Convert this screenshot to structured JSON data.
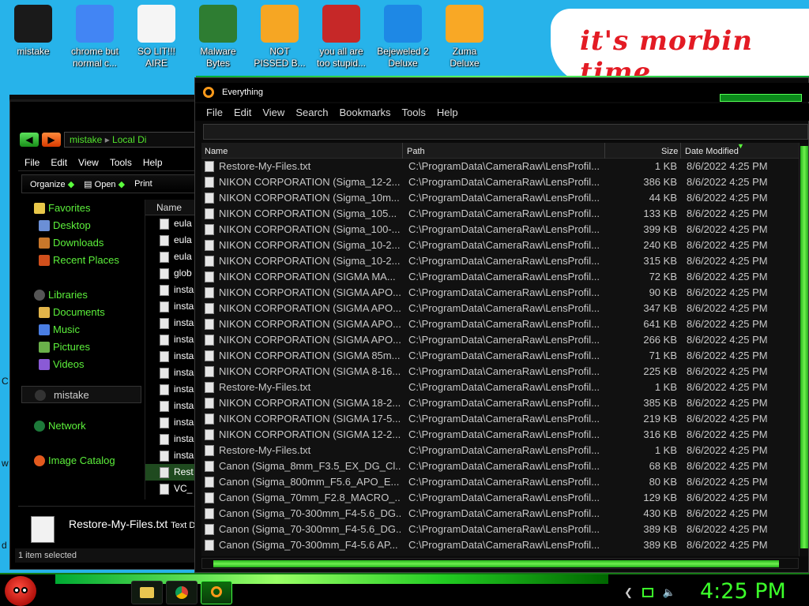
{
  "desktop": {
    "icons": [
      {
        "label": "mistake",
        "icon": "black-disc-icon",
        "color": "#1a1a1a"
      },
      {
        "label": "chrome but\nnormal c...",
        "icon": "chrome-icon",
        "color": "#4285f4"
      },
      {
        "label": "SO LIT!!!\nAIRE",
        "icon": "solitaire-card-icon",
        "color": "#f5f5f5"
      },
      {
        "label": "Malware\nBytes",
        "icon": "shield-check-icon",
        "color": "#2e7d32"
      },
      {
        "label": "NOT\nPISSED B...",
        "icon": "green-pig-icon",
        "color": "#f6a623"
      },
      {
        "label": "you all are\ntoo stupid...",
        "icon": "devcpp-icon",
        "color": "#c62828"
      },
      {
        "label": "Bejeweled 2\nDeluxe",
        "icon": "gem-icon",
        "color": "#1e88e5"
      },
      {
        "label": "Zuma\nDeluxe",
        "icon": "zuma-icon",
        "color": "#f9a825"
      }
    ],
    "sticker_text": "it's morbin time",
    "edge_letters": [
      "C",
      "w",
      "d"
    ]
  },
  "explorer": {
    "address_segments": [
      "mistake",
      "Local Di"
    ],
    "menu": [
      "File",
      "Edit",
      "View",
      "Tools",
      "Help"
    ],
    "toolbar": {
      "organize": "Organize",
      "open": "Open",
      "print": "Print"
    },
    "sidebar": {
      "favorites": "Favorites",
      "favorites_items": [
        "Desktop",
        "Downloads",
        "Recent Places"
      ],
      "libraries": "Libraries",
      "libraries_items": [
        "Documents",
        "Music",
        "Pictures",
        "Videos"
      ],
      "location": "mistake",
      "network": "Network",
      "image_catalog": "Image Catalog"
    },
    "list_header": "Name",
    "list_items": [
      "eula",
      "eula",
      "eula",
      "glob",
      "insta",
      "insta",
      "insta",
      "insta",
      "insta",
      "insta",
      "insta",
      "insta",
      "insta",
      "insta",
      "insta",
      "Rest",
      "VC_"
    ],
    "detail_name": "Restore-My-Files.txt",
    "detail_type": "Text D",
    "status": "1 item selected"
  },
  "everything": {
    "title": "Everything",
    "menu": [
      "File",
      "Edit",
      "View",
      "Search",
      "Bookmarks",
      "Tools",
      "Help"
    ],
    "search_value": "",
    "columns": [
      "Name",
      "Path",
      "Size",
      "Date Modified"
    ],
    "rows": [
      [
        "Restore-My-Files.txt",
        "C:\\ProgramData\\CameraRaw\\LensProfil...",
        "1 KB",
        "8/6/2022 4:25 PM"
      ],
      [
        "NIKON CORPORATION (Sigma_12-2...",
        "C:\\ProgramData\\CameraRaw\\LensProfil...",
        "386 KB",
        "8/6/2022 4:25 PM"
      ],
      [
        "NIKON CORPORATION (Sigma_10m...",
        "C:\\ProgramData\\CameraRaw\\LensProfil...",
        "44 KB",
        "8/6/2022 4:25 PM"
      ],
      [
        "NIKON CORPORATION (Sigma_105...",
        "C:\\ProgramData\\CameraRaw\\LensProfil...",
        "133 KB",
        "8/6/2022 4:25 PM"
      ],
      [
        "NIKON CORPORATION (Sigma_100-...",
        "C:\\ProgramData\\CameraRaw\\LensProfil...",
        "399 KB",
        "8/6/2022 4:25 PM"
      ],
      [
        "NIKON CORPORATION (Sigma_10-2...",
        "C:\\ProgramData\\CameraRaw\\LensProfil...",
        "240 KB",
        "8/6/2022 4:25 PM"
      ],
      [
        "NIKON CORPORATION (Sigma_10-2...",
        "C:\\ProgramData\\CameraRaw\\LensProfil...",
        "315 KB",
        "8/6/2022 4:25 PM"
      ],
      [
        "NIKON CORPORATION (SIGMA MA...",
        "C:\\ProgramData\\CameraRaw\\LensProfil...",
        "72 KB",
        "8/6/2022 4:25 PM"
      ],
      [
        "NIKON CORPORATION (SIGMA APO...",
        "C:\\ProgramData\\CameraRaw\\LensProfil...",
        "90 KB",
        "8/6/2022 4:25 PM"
      ],
      [
        "NIKON CORPORATION (SIGMA APO...",
        "C:\\ProgramData\\CameraRaw\\LensProfil...",
        "347 KB",
        "8/6/2022 4:25 PM"
      ],
      [
        "NIKON CORPORATION (SIGMA APO...",
        "C:\\ProgramData\\CameraRaw\\LensProfil...",
        "641 KB",
        "8/6/2022 4:25 PM"
      ],
      [
        "NIKON CORPORATION (SIGMA APO...",
        "C:\\ProgramData\\CameraRaw\\LensProfil...",
        "266 KB",
        "8/6/2022 4:25 PM"
      ],
      [
        "NIKON CORPORATION (SIGMA 85m...",
        "C:\\ProgramData\\CameraRaw\\LensProfil...",
        "71 KB",
        "8/6/2022 4:25 PM"
      ],
      [
        "NIKON CORPORATION (SIGMA 8-16...",
        "C:\\ProgramData\\CameraRaw\\LensProfil...",
        "225 KB",
        "8/6/2022 4:25 PM"
      ],
      [
        "Restore-My-Files.txt",
        "C:\\ProgramData\\CameraRaw\\LensProfil...",
        "1 KB",
        "8/6/2022 4:25 PM"
      ],
      [
        "NIKON CORPORATION (SIGMA 18-2...",
        "C:\\ProgramData\\CameraRaw\\LensProfil...",
        "385 KB",
        "8/6/2022 4:25 PM"
      ],
      [
        "NIKON CORPORATION (SIGMA 17-5...",
        "C:\\ProgramData\\CameraRaw\\LensProfil...",
        "219 KB",
        "8/6/2022 4:25 PM"
      ],
      [
        "NIKON CORPORATION (SIGMA 12-2...",
        "C:\\ProgramData\\CameraRaw\\LensProfil...",
        "316 KB",
        "8/6/2022 4:25 PM"
      ],
      [
        "Restore-My-Files.txt",
        "C:\\ProgramData\\CameraRaw\\LensProfil...",
        "1 KB",
        "8/6/2022 4:25 PM"
      ],
      [
        "Canon (Sigma_8mm_F3.5_EX_DG_Cl...",
        "C:\\ProgramData\\CameraRaw\\LensProfil...",
        "68 KB",
        "8/6/2022 4:25 PM"
      ],
      [
        "Canon (Sigma_800mm_F5.6_APO_E...",
        "C:\\ProgramData\\CameraRaw\\LensProfil...",
        "80 KB",
        "8/6/2022 4:25 PM"
      ],
      [
        "Canon (Sigma_70mm_F2.8_MACRO_...",
        "C:\\ProgramData\\CameraRaw\\LensProfil...",
        "129 KB",
        "8/6/2022 4:25 PM"
      ],
      [
        "Canon (Sigma_70-300mm_F4-5.6_DG...",
        "C:\\ProgramData\\CameraRaw\\LensProfil...",
        "430 KB",
        "8/6/2022 4:25 PM"
      ],
      [
        "Canon (Sigma_70-300mm_F4-5.6_DG...",
        "C:\\ProgramData\\CameraRaw\\LensProfil...",
        "389 KB",
        "8/6/2022 4:25 PM"
      ],
      [
        "Canon (Sigma_70-300mm_F4-5.6 AP...",
        "C:\\ProgramData\\CameraRaw\\LensProfil...",
        "389 KB",
        "8/6/2022 4:25 PM"
      ]
    ]
  },
  "taskbar": {
    "clock": "4:25 PM",
    "pinned": [
      {
        "name": "explorer-icon",
        "active": false
      },
      {
        "name": "chrome-icon",
        "active": false
      },
      {
        "name": "everything-search-icon",
        "active": true
      }
    ]
  },
  "colors": {
    "accent_green": "#3cff2a",
    "desktop_blue": "#27b3ea",
    "sticker_red": "#e31b24"
  }
}
